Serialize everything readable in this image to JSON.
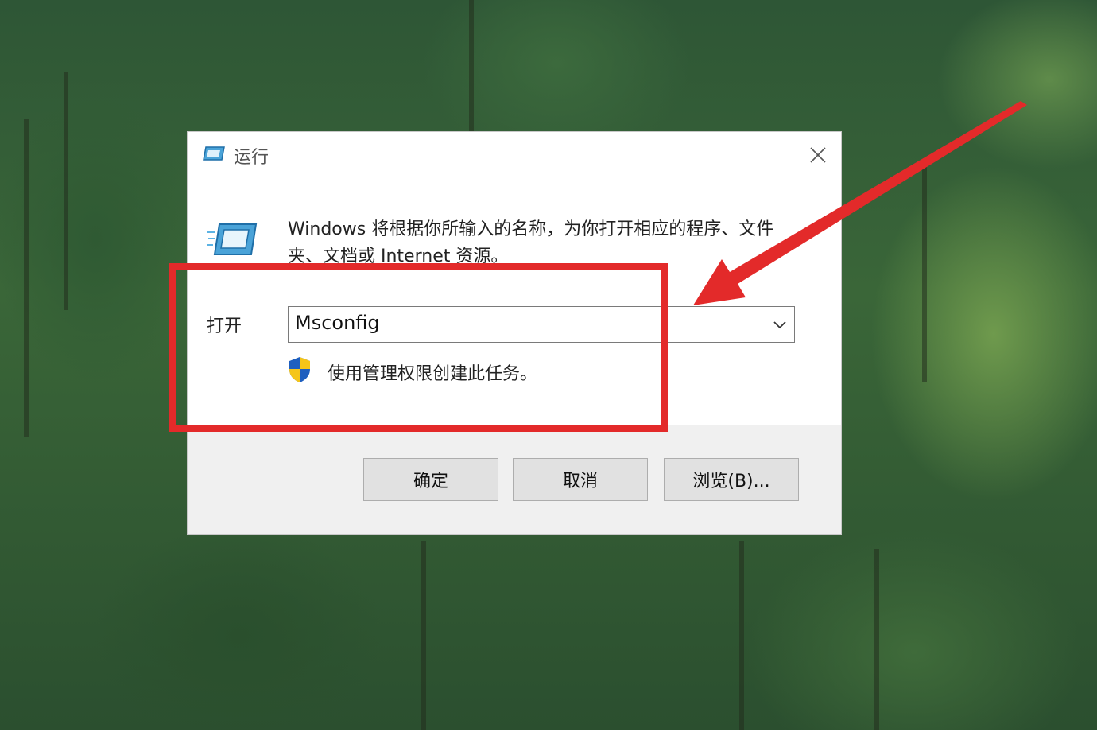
{
  "window": {
    "title": "运行",
    "title_icon": "run-app-icon",
    "close_icon": "close-icon"
  },
  "content": {
    "description": "Windows 将根据你所输入的名称，为你打开相应的程序、文件夹、文档或 Internet 资源。",
    "app_icon": "run-app-icon"
  },
  "open_field": {
    "label": "打开",
    "value": "Msconfig",
    "dropdown_icon": "chevron-down-icon"
  },
  "admin_note": {
    "icon": "uac-shield-icon",
    "text": "使用管理权限创建此任务。"
  },
  "buttons": {
    "ok": "确定",
    "cancel": "取消",
    "browse": "浏览(B)..."
  },
  "annotation": {
    "color": "#e32a2a"
  }
}
